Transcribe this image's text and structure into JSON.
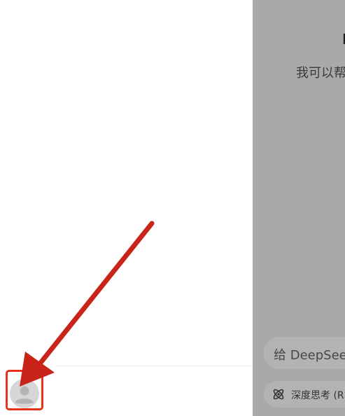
{
  "main": {
    "title": "D",
    "subtitle": "我可以帮",
    "input_placeholder": "给 DeepSee",
    "deepthink_label": "深度思考 (R"
  },
  "colors": {
    "drawer_background": "#ffffff",
    "dim_overlay": "#a9a9a9",
    "highlight": "#e8331c",
    "arrow": "#c9241a"
  },
  "icons": {
    "avatar": "user-avatar-icon",
    "deepthink": "atom-icon"
  }
}
